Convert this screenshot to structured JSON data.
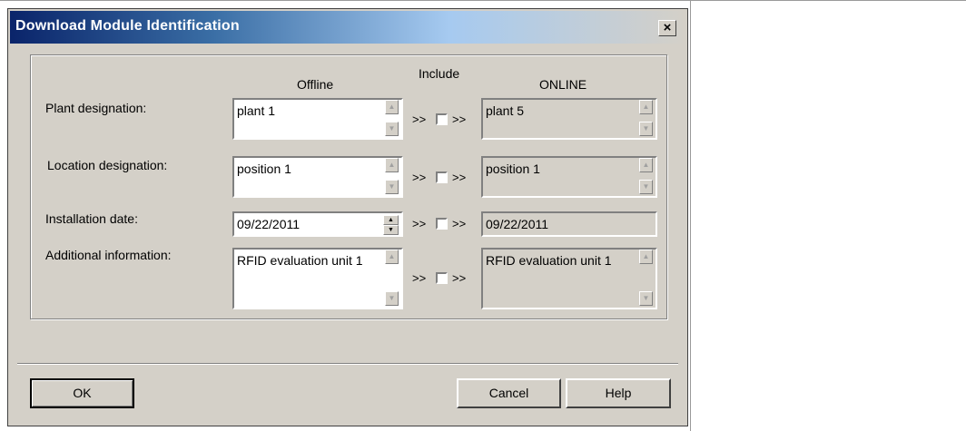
{
  "dialog": {
    "title": "Download Module Identification",
    "close_symbol": "×"
  },
  "columns": {
    "offline": "Offline",
    "include": "Include",
    "online": "ONLINE"
  },
  "separator": ">> ☐ >>",
  "rows": [
    {
      "label": "Plant designation:",
      "offline": "plant 1",
      "online": "plant 5"
    },
    {
      "label": "Location designation:",
      "offline": "position 1",
      "online": "position 1"
    },
    {
      "label": "Installation date:",
      "offline": "09/22/2011",
      "online": "09/22/2011"
    },
    {
      "label": "Additional information:",
      "offline": "RFID evaluation unit 1",
      "online": "RFID evaluation unit 1"
    }
  ],
  "include_arrow": ">>",
  "buttons": {
    "ok": "OK",
    "cancel": "Cancel",
    "help": "Help"
  },
  "icons": {
    "scroll_up": "scroll-up-arrow-icon",
    "scroll_down": "scroll-down-arrow-icon",
    "spin": "spin-updown-icon",
    "close": "close-icon"
  },
  "colors": {
    "titlebar_start": "#0a246a",
    "dialog_face": "#d4d0c8"
  }
}
